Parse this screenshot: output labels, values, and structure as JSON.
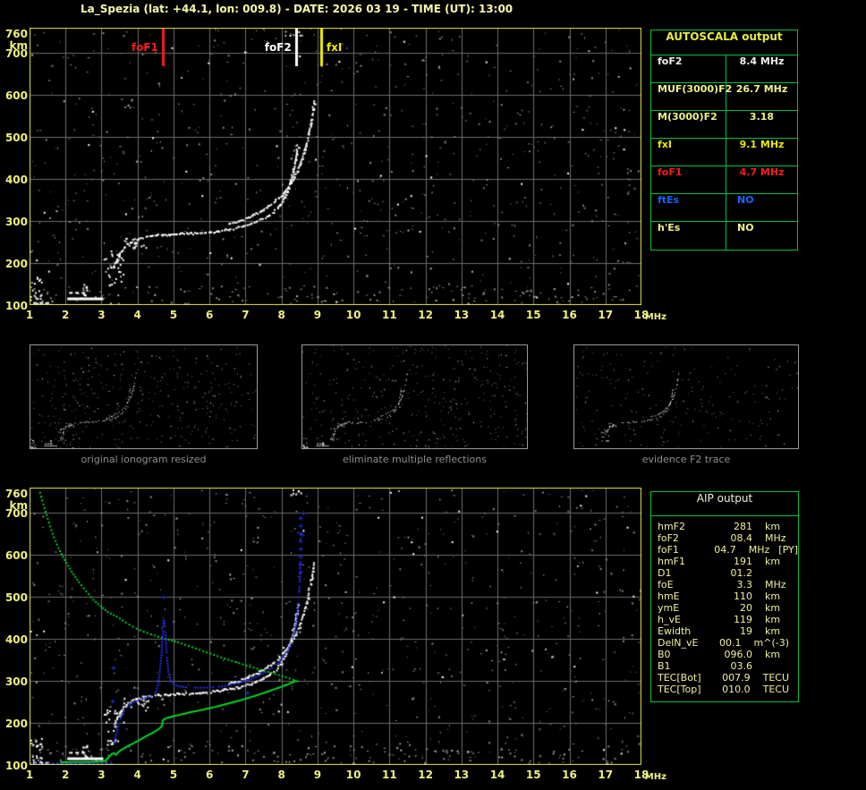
{
  "header": {
    "title": "La_Spezia (lat: +44.1, lon: 009.8) - DATE: 2026 03 19 - TIME (UT): 13:00"
  },
  "colors": {
    "background": "#000000",
    "frame": "#e8e838",
    "grid": "#6b6b6b",
    "axis_text": "#f0f080",
    "title_text": "#f8f8a8",
    "trace_white": "#ffffff",
    "noise_gray": "#8a8a8a",
    "noise_dim": "#6f6f6f",
    "noise_bright": "#b4b4b4",
    "profile_green": "#00d428",
    "restored_blue": "#2330f0",
    "table_border": "#00c040",
    "autoscala_header": "#e8e84a",
    "white_text": "#f0f0f0",
    "pale_yellow_text": "#f0f088",
    "yellow_text": "#e8e800",
    "red_text": "#ff1a1a",
    "blue_text": "#1464ff",
    "aip_text": "#f0f0a0",
    "aip_header": "#f0f0d8",
    "caption_gray": "#8f8f8f"
  },
  "autoscala_table": {
    "title": "AUTOSCALA output",
    "rows": [
      {
        "label": "foF2",
        "value": "8.4 MHz",
        "color": "#f0f0f0",
        "value_align": "center"
      },
      {
        "label": "MUF(3000)F2",
        "value": "26.7 MHz",
        "color": "#f0f088",
        "value_align": "center"
      },
      {
        "label": "M(3000)F2",
        "value": "3.18",
        "color": "#f0f088",
        "value_align": "center"
      },
      {
        "label": "fxI",
        "value": "9.1 MHz",
        "color": "#e8e800",
        "value_align": "center"
      },
      {
        "label": "foF1",
        "value": "4.7 MHz",
        "color": "#ff1a1a",
        "value_align": "center"
      },
      {
        "label": "ftEs",
        "value": "NO",
        "color": "#1464ff",
        "value_align": "left"
      },
      {
        "label": "h'Es",
        "value": "NO",
        "color": "#f0f088",
        "value_align": "left"
      }
    ]
  },
  "aip_table": {
    "title": "AIP output",
    "rows": [
      {
        "label": "hmF2",
        "value": "281",
        "unit": "km",
        "extra": ""
      },
      {
        "label": "foF2",
        "value": "08.4",
        "unit": "MHz",
        "extra": ""
      },
      {
        "label": "foF1",
        "value": "04.7",
        "unit": "MHz",
        "extra": "[PY]"
      },
      {
        "label": "hmF1",
        "value": "191",
        "unit": "km",
        "extra": ""
      },
      {
        "label": "D1",
        "value": "01.2",
        "unit": "",
        "extra": ""
      },
      {
        "label": "foE",
        "value": "3.3",
        "unit": "MHz",
        "extra": ""
      },
      {
        "label": "hmE",
        "value": "110",
        "unit": "km",
        "extra": ""
      },
      {
        "label": "ymE",
        "value": "20",
        "unit": "km",
        "extra": ""
      },
      {
        "label": "h_vE",
        "value": "119",
        "unit": "km",
        "extra": ""
      },
      {
        "label": "Ewidth",
        "value": "19",
        "unit": "km",
        "extra": ""
      },
      {
        "label": "DelN_vE",
        "value": "00.1",
        "unit": "m^(-3)",
        "extra": ""
      },
      {
        "label": "B0",
        "value": "096.0",
        "unit": "km",
        "extra": ""
      },
      {
        "label": "B1",
        "value": "03.6",
        "unit": "",
        "extra": ""
      },
      {
        "label": "TEC[Bot]",
        "value": "007.9",
        "unit": "TECU",
        "extra": ""
      },
      {
        "label": "TEC[Top]",
        "value": "010.0",
        "unit": "TECU",
        "extra": ""
      }
    ]
  },
  "thumbnails": [
    {
      "caption": "original ionogram resized"
    },
    {
      "caption": "eliminate multiple reflections"
    },
    {
      "caption": "evidence F2 trace"
    }
  ],
  "chart_data": {
    "type": "scatter",
    "title": "Autoscala ionogram - La Spezia 2026-03-19 13:00 UT",
    "xlabel": "MHz",
    "ylabel": "km",
    "xlim": [
      1,
      18
    ],
    "ylim": [
      100,
      760
    ],
    "grid": true,
    "x_ticks": [
      1,
      2,
      3,
      4,
      5,
      6,
      7,
      8,
      9,
      10,
      11,
      12,
      13,
      14,
      15,
      16,
      17,
      18
    ],
    "y_ticks": [
      760,
      700,
      600,
      500,
      400,
      300,
      200,
      100
    ],
    "markers": [
      {
        "name": "foF1",
        "label": "foF1",
        "f": 4.7,
        "color": "#ff1a1a",
        "side": "left"
      },
      {
        "name": "foF2",
        "label": "foF2",
        "f": 8.4,
        "color": "#ffffff",
        "side": "left"
      },
      {
        "name": "fxI",
        "label": "fxI",
        "f": 9.1,
        "color": "#f0f000",
        "side": "right"
      }
    ],
    "o_trace": [
      [
        3.35,
        193
      ],
      [
        3.42,
        205
      ],
      [
        3.5,
        220
      ],
      [
        3.6,
        233
      ],
      [
        3.72,
        243
      ],
      [
        3.85,
        251
      ],
      [
        4.0,
        257
      ],
      [
        4.2,
        262
      ],
      [
        4.45,
        265
      ],
      [
        4.7,
        267
      ],
      [
        5.0,
        268
      ],
      [
        5.3,
        269
      ],
      [
        5.6,
        270
      ],
      [
        5.9,
        272
      ],
      [
        6.2,
        275
      ],
      [
        6.5,
        279
      ],
      [
        6.8,
        284
      ],
      [
        7.1,
        291
      ],
      [
        7.4,
        301
      ],
      [
        7.65,
        313
      ],
      [
        7.85,
        327
      ],
      [
        8.0,
        342
      ],
      [
        8.12,
        360
      ],
      [
        8.22,
        381
      ],
      [
        8.3,
        405
      ],
      [
        8.37,
        432
      ],
      [
        8.42,
        458
      ],
      [
        8.46,
        478
      ]
    ],
    "x_trace": [
      [
        6.55,
        293
      ],
      [
        6.8,
        299
      ],
      [
        7.05,
        307
      ],
      [
        7.3,
        317
      ],
      [
        7.55,
        329
      ],
      [
        7.8,
        344
      ],
      [
        8.0,
        360
      ],
      [
        8.18,
        379
      ],
      [
        8.33,
        400
      ],
      [
        8.47,
        424
      ],
      [
        8.58,
        450
      ],
      [
        8.68,
        478
      ],
      [
        8.76,
        508
      ],
      [
        8.83,
        537
      ],
      [
        8.88,
        562
      ],
      [
        8.91,
        585
      ]
    ],
    "es_segments": [
      {
        "f1": 2.05,
        "f2": 3.05,
        "km": 118,
        "thick": 3,
        "style": "solid"
      },
      {
        "f1": 2.1,
        "f2": 2.6,
        "km": 131,
        "thick": 2,
        "style": "dash"
      },
      {
        "f1": 1.1,
        "f2": 1.45,
        "km": 107,
        "thick": 2,
        "style": "dash"
      }
    ],
    "clusters": [
      {
        "f1": 1.0,
        "f2": 1.35,
        "km1": 100,
        "km2": 168,
        "n": 22
      },
      {
        "f1": 2.45,
        "f2": 2.58,
        "km1": 118,
        "km2": 152,
        "n": 9
      },
      {
        "f1": 3.05,
        "f2": 3.6,
        "km1": 148,
        "km2": 232,
        "n": 30
      },
      {
        "f1": 3.6,
        "f2": 4.3,
        "km1": 238,
        "km2": 262,
        "n": 18
      },
      {
        "f1": 8.05,
        "f2": 8.55,
        "km1": 742,
        "km2": 758,
        "n": 7
      }
    ],
    "profile_bottomside": [
      [
        1.85,
        106
      ],
      [
        2.3,
        107
      ],
      [
        2.7,
        107
      ],
      [
        3.0,
        108
      ],
      [
        3.1,
        110
      ],
      [
        3.2,
        118
      ],
      [
        3.28,
        126
      ],
      [
        3.34,
        128
      ],
      [
        3.4,
        124
      ],
      [
        3.5,
        133
      ],
      [
        3.65,
        141
      ],
      [
        3.85,
        150
      ],
      [
        4.05,
        159
      ],
      [
        4.25,
        169
      ],
      [
        4.45,
        178
      ],
      [
        4.6,
        186
      ],
      [
        4.68,
        193
      ],
      [
        4.7,
        206
      ],
      [
        4.78,
        211
      ],
      [
        4.95,
        215
      ],
      [
        5.2,
        220
      ],
      [
        5.5,
        226
      ],
      [
        5.85,
        232
      ],
      [
        6.2,
        239
      ],
      [
        6.55,
        247
      ],
      [
        6.9,
        255
      ],
      [
        7.25,
        264
      ],
      [
        7.6,
        274
      ],
      [
        7.9,
        283
      ],
      [
        8.15,
        291
      ],
      [
        8.32,
        297
      ],
      [
        8.42,
        301
      ]
    ],
    "profile_topside": [
      [
        8.42,
        301
      ],
      [
        8.2,
        308
      ],
      [
        7.9,
        316
      ],
      [
        7.5,
        326
      ],
      [
        7.1,
        336
      ],
      [
        6.7,
        347
      ],
      [
        6.3,
        358
      ],
      [
        5.9,
        370
      ],
      [
        5.5,
        382
      ],
      [
        5.1,
        394
      ],
      [
        4.85,
        400
      ],
      [
        4.55,
        407
      ],
      [
        4.25,
        416
      ],
      [
        3.95,
        426
      ],
      [
        3.65,
        441
      ],
      [
        3.4,
        455
      ],
      [
        3.15,
        466
      ],
      [
        2.95,
        480
      ],
      [
        2.75,
        495
      ],
      [
        2.55,
        515
      ],
      [
        2.35,
        537
      ],
      [
        2.15,
        562
      ],
      [
        1.95,
        590
      ],
      [
        1.78,
        618
      ],
      [
        1.62,
        652
      ],
      [
        1.48,
        688
      ],
      [
        1.36,
        722
      ],
      [
        1.27,
        750
      ],
      [
        1.22,
        762
      ]
    ],
    "blue_flat": {
      "f1": 1.0,
      "f2": 3.3,
      "km": 105
    },
    "blue_path": [
      [
        3.35,
        152
      ],
      [
        3.42,
        178
      ],
      [
        3.5,
        205
      ],
      [
        3.62,
        228
      ],
      [
        3.78,
        243
      ],
      [
        3.95,
        252
      ],
      [
        4.12,
        258
      ],
      [
        4.3,
        262
      ],
      [
        4.45,
        267
      ],
      [
        4.52,
        276
      ],
      [
        4.58,
        295
      ],
      [
        4.62,
        322
      ],
      [
        4.66,
        355
      ],
      [
        4.69,
        392
      ],
      [
        4.71,
        425
      ],
      [
        4.73,
        450
      ],
      [
        4.76,
        430
      ],
      [
        4.79,
        395
      ],
      [
        4.82,
        355
      ],
      [
        4.86,
        322
      ],
      [
        4.92,
        302
      ],
      [
        5.0,
        292
      ],
      [
        5.15,
        287
      ],
      [
        5.35,
        285
      ],
      [
        5.6,
        284
      ],
      [
        5.85,
        284
      ],
      [
        6.1,
        285
      ],
      [
        6.35,
        287
      ],
      [
        6.6,
        291
      ],
      [
        6.85,
        296
      ],
      [
        7.1,
        303
      ],
      [
        7.35,
        312
      ],
      [
        7.6,
        323
      ],
      [
        7.8,
        335
      ],
      [
        8.0,
        350
      ],
      [
        8.15,
        368
      ],
      [
        8.27,
        390
      ],
      [
        8.36,
        416
      ],
      [
        8.42,
        445
      ],
      [
        8.46,
        478
      ],
      [
        8.49,
        512
      ],
      [
        8.51,
        548
      ],
      [
        8.52,
        582
      ]
    ],
    "blue_asymptote": {
      "f": 8.52,
      "km1": 560,
      "km2": 688,
      "n": 8
    },
    "blue_isolated": [
      [
        3.32,
        332
      ],
      [
        3.3,
        252
      ],
      [
        4.71,
        500
      ],
      [
        8.57,
        648
      ],
      [
        8.6,
        700
      ],
      [
        7.05,
        272
      ]
    ],
    "autoscala_values": {
      "foF2_MHz": 8.4,
      "MUF3000F2_MHz": 26.7,
      "M3000F2": 3.18,
      "fxI_MHz": 9.1,
      "foF1_MHz": 4.7,
      "ftEs": "NO",
      "hpEs": "NO"
    }
  }
}
